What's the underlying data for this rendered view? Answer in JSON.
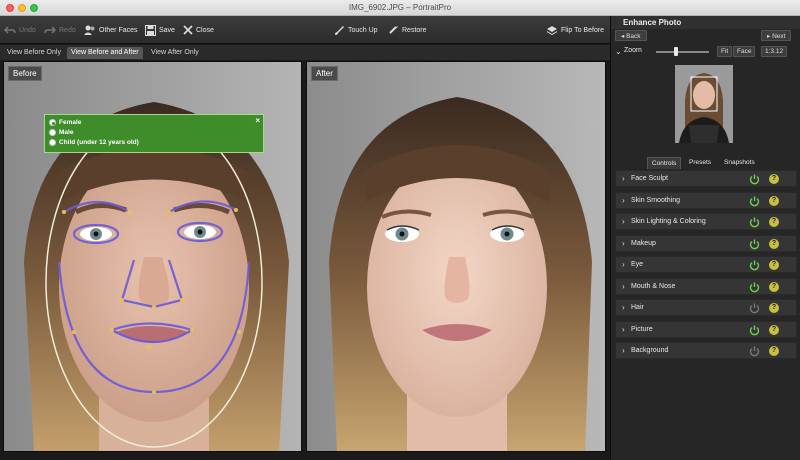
{
  "window": {
    "title": "IMG_6902.JPG – PortraitPro"
  },
  "toolbar": {
    "undo": "Undo",
    "redo": "Redo",
    "other_faces": "Other Faces",
    "save": "Save",
    "close": "Close",
    "touch_up": "Touch Up",
    "restore": "Restore",
    "flip_to_before": "Flip To Before"
  },
  "view_tabs": [
    "View Before Only",
    "View Before and After",
    "View After Only"
  ],
  "active_view_tab": "View Before and After",
  "panels": {
    "before": "Before",
    "after": "After"
  },
  "gender_popup": {
    "options": [
      "Female",
      "Male",
      "Child (under 12 years old)"
    ],
    "selected": "Female",
    "close": "×"
  },
  "right_panel": {
    "title": "Enhance Photo",
    "back": "Back",
    "next": "Next",
    "zoom_label": "Zoom",
    "fit": "Fit",
    "face": "Face",
    "zoom_value": "1:3.12",
    "tabs": [
      "Controls",
      "Presets",
      "Snapshots"
    ],
    "active_tab": "Controls",
    "controls": [
      {
        "label": "Face Sculpt",
        "enabled": true
      },
      {
        "label": "Skin Smoothing",
        "enabled": true
      },
      {
        "label": "Skin Lighting & Coloring",
        "enabled": true
      },
      {
        "label": "Makeup",
        "enabled": true
      },
      {
        "label": "Eye",
        "enabled": true
      },
      {
        "label": "Mouth & Nose",
        "enabled": true
      },
      {
        "label": "Hair",
        "enabled": false
      },
      {
        "label": "Picture",
        "enabled": true
      },
      {
        "label": "Background",
        "enabled": false
      }
    ],
    "help": "?"
  },
  "colors": {
    "accent_green": "#3f8d2a",
    "power_on": "#6bd24a",
    "power_off": "#777777",
    "help_yellow": "#c8c040"
  }
}
